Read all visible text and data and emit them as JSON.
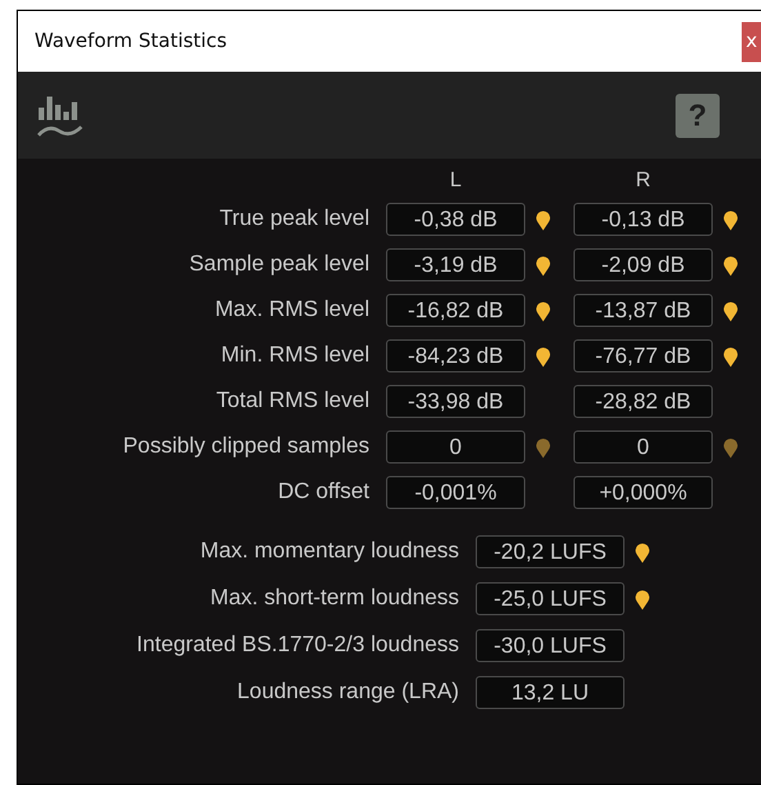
{
  "window": {
    "title": "Waveform Statistics",
    "close_label": "x"
  },
  "toolbar": {
    "help_label": "?"
  },
  "channel_headers": [
    "L",
    "R"
  ],
  "channel_rows": [
    {
      "label": "True peak level",
      "cells": [
        {
          "value": "-0,38 dB",
          "marker": true,
          "marker_dim": false
        },
        {
          "value": "-0,13 dB",
          "marker": true,
          "marker_dim": false
        }
      ]
    },
    {
      "label": "Sample peak level",
      "cells": [
        {
          "value": "-3,19 dB",
          "marker": true,
          "marker_dim": false
        },
        {
          "value": "-2,09 dB",
          "marker": true,
          "marker_dim": false
        }
      ]
    },
    {
      "label": "Max. RMS level",
      "cells": [
        {
          "value": "-16,82 dB",
          "marker": true,
          "marker_dim": false
        },
        {
          "value": "-13,87 dB",
          "marker": true,
          "marker_dim": false
        }
      ]
    },
    {
      "label": "Min. RMS level",
      "cells": [
        {
          "value": "-84,23 dB",
          "marker": true,
          "marker_dim": false
        },
        {
          "value": "-76,77 dB",
          "marker": true,
          "marker_dim": false
        }
      ]
    },
    {
      "label": "Total RMS level",
      "cells": [
        {
          "value": "-33,98 dB",
          "marker": false
        },
        {
          "value": "-28,82 dB",
          "marker": false
        }
      ]
    },
    {
      "label": "Possibly clipped samples",
      "cells": [
        {
          "value": "0",
          "marker": true,
          "marker_dim": true
        },
        {
          "value": "0",
          "marker": true,
          "marker_dim": true
        }
      ]
    },
    {
      "label": "DC offset",
      "cells": [
        {
          "value": "-0,001%",
          "marker": false
        },
        {
          "value": "+0,000%",
          "marker": false
        }
      ]
    }
  ],
  "loudness_rows": [
    {
      "label": "Max. momentary loudness",
      "value": "-20,2 LUFS",
      "marker": true,
      "marker_dim": false
    },
    {
      "label": "Max. short-term loudness",
      "value": "-25,0 LUFS",
      "marker": true,
      "marker_dim": false
    },
    {
      "label": "Integrated BS.1770-2/3 loudness",
      "value": "-30,0 LUFS",
      "marker": false
    },
    {
      "label": "Loudness range (LRA)",
      "value": "13,2 LU",
      "marker": false
    }
  ]
}
